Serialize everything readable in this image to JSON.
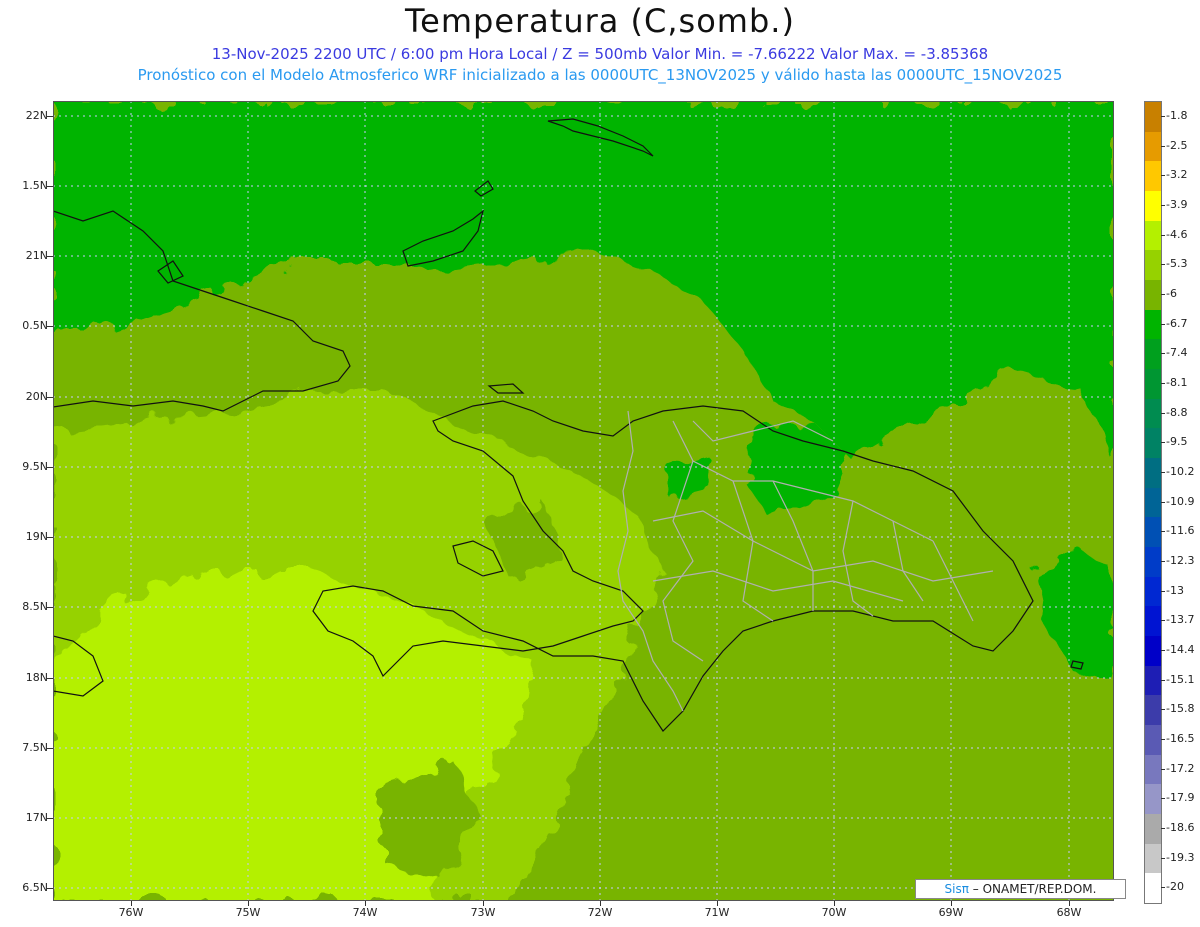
{
  "title": "Temperatura (C,somb.)",
  "subtitle_line1": "13-Nov-2025  2200 UTC / 6:00 pm Hora Local / Z = 500mb  Valor Min. = -7.66222  Valor Max. = -3.85368",
  "subtitle_line2": "Pronóstico con el Modelo Atmosferico WRF inicializado a las 0000UTC_13NOV2025 y válido hasta las  0000UTC_15NOV2025",
  "y_axis_labels": [
    "22N",
    "1.5N",
    "21N",
    "0.5N",
    "20N",
    "9.5N",
    "19N",
    "8.5N",
    "18N",
    "7.5N",
    "17N",
    "6.5N"
  ],
  "x_axis_labels": [
    "76W",
    "75W",
    "74W",
    "73W",
    "72W",
    "71W",
    "70W",
    "69W",
    "68W"
  ],
  "credit": {
    "brand": "Sisπ",
    "text": " – ONAMET/REP.DOM."
  },
  "colorbar": {
    "labels": [
      "-1.8",
      "-2.5",
      "-3.2",
      "-3.9",
      "-4.6",
      "-5.3",
      "-6",
      "-6.7",
      "-7.4",
      "-8.1",
      "-8.8",
      "-9.5",
      "-10.2",
      "-10.9",
      "-11.6",
      "-12.3",
      "-13",
      "-13.7",
      "-14.4",
      "-15.1",
      "-15.8",
      "-16.5",
      "-17.2",
      "-17.9",
      "-18.6",
      "-19.3",
      "-20"
    ],
    "colors": [
      "#c88000",
      "#e69b00",
      "#ffc800",
      "#ffff00",
      "#b4f000",
      "#96d200",
      "#78b400",
      "#00b400",
      "#00a01e",
      "#009632",
      "#008c50",
      "#008264",
      "#006e82",
      "#006496",
      "#0050b4",
      "#003cc8",
      "#0028d2",
      "#0014d2",
      "#0000c8",
      "#1e1eb4",
      "#3c3caa",
      "#5a5ab4",
      "#7878be",
      "#9696c8",
      "#aaaaaa",
      "#c8c8c8",
      "#ffffff"
    ]
  },
  "map_fields": {
    "north_region_temp_class": "-6.7",
    "central_band_temp_class": "-6",
    "southwest_temp_class": "-4.6"
  }
}
